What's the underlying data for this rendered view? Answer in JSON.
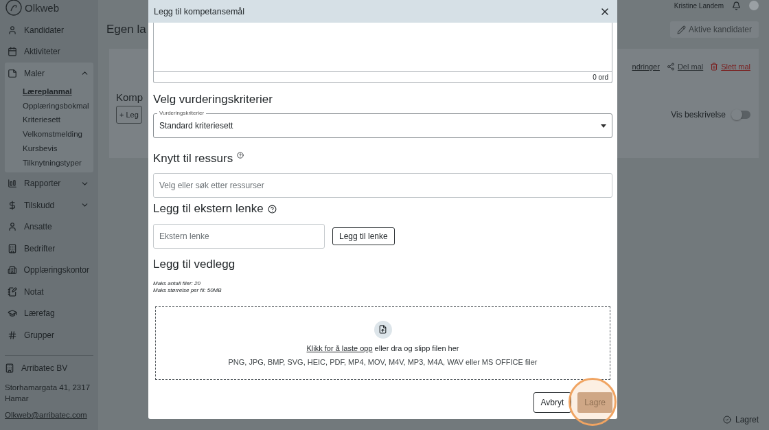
{
  "topbar": {
    "user_name": "Kristine Landem"
  },
  "sidebar": {
    "logo": "Olkweb",
    "items": [
      {
        "label": "Kandidater",
        "kind": "link"
      },
      {
        "label": "Aktiviteter",
        "kind": "link"
      },
      {
        "label": "Maler",
        "kind": "group",
        "expanded": true,
        "children": [
          {
            "label": "Læreplanmal",
            "selected": true
          },
          {
            "label": "Opplæringsbokmal",
            "selected": false
          },
          {
            "label": "Kriteriesett",
            "selected": false
          },
          {
            "label": "Velkomstmelding",
            "selected": false
          },
          {
            "label": "Kursbevis",
            "selected": false
          },
          {
            "label": "Tilknytningstyper",
            "selected": false
          }
        ]
      },
      {
        "label": "Rapporter",
        "kind": "group",
        "expanded": false
      },
      {
        "label": "Tilskudd",
        "kind": "group",
        "expanded": false
      },
      {
        "label": "Ansatte",
        "kind": "link"
      },
      {
        "label": "Bedrifter",
        "kind": "link"
      },
      {
        "label": "Opplæringskontor",
        "kind": "link"
      },
      {
        "label": "Notat",
        "kind": "link"
      },
      {
        "label": "Lærefag",
        "kind": "link"
      },
      {
        "label": "Grupper",
        "kind": "link"
      }
    ],
    "company": {
      "name": "Arribatec BV",
      "address": "Storhamargata 41, 2317 Hamar",
      "email": "Olkweb@arribatec.com"
    }
  },
  "main": {
    "title": "Egen la",
    "header_button": "Aktive kandidater",
    "actions": [
      {
        "label": "ndringer",
        "kind": "plain"
      },
      {
        "label": "Del mal",
        "kind": "share"
      },
      {
        "label": "Slett mal",
        "kind": "delete"
      }
    ],
    "section_title": "Komp",
    "add_button": "+ Leg",
    "toggle": {
      "label": "Vis beskrivelse",
      "on": false
    },
    "status": "Lagret"
  },
  "modal": {
    "title": "Legg til kompetansemål",
    "word_count": "0 ord",
    "criteria": {
      "heading": "Velg vurderingskriterier",
      "label": "Vurderingskriterier",
      "value": "Standard kriteriesett"
    },
    "resource": {
      "heading": "Knytt til ressurs",
      "placeholder": "Velg eller søk etter ressurser"
    },
    "link": {
      "heading": "Legg til ekstern lenke",
      "placeholder": "Ekstern lenke",
      "button": "Legg til lenke"
    },
    "attachments": {
      "heading": "Legg til vedlegg",
      "limits": [
        "Maks antall filer: 20",
        "Maks størrelse per fil: 50MB"
      ],
      "upload_link": "Klikk for å laste opp",
      "upload_text": " eller dra og slipp filen her",
      "formats": "PNG, JPG, BMP, SVG, HEIC, PDF, MP4, MOV, M4V, MP3, M4A, WAV eller MS OFFICE filer"
    },
    "buttons": [
      {
        "label": "Avbryt",
        "kind": "cancel",
        "disabled": false
      },
      {
        "label": "Lagre",
        "kind": "save",
        "disabled": true,
        "highlighted": true
      }
    ]
  }
}
